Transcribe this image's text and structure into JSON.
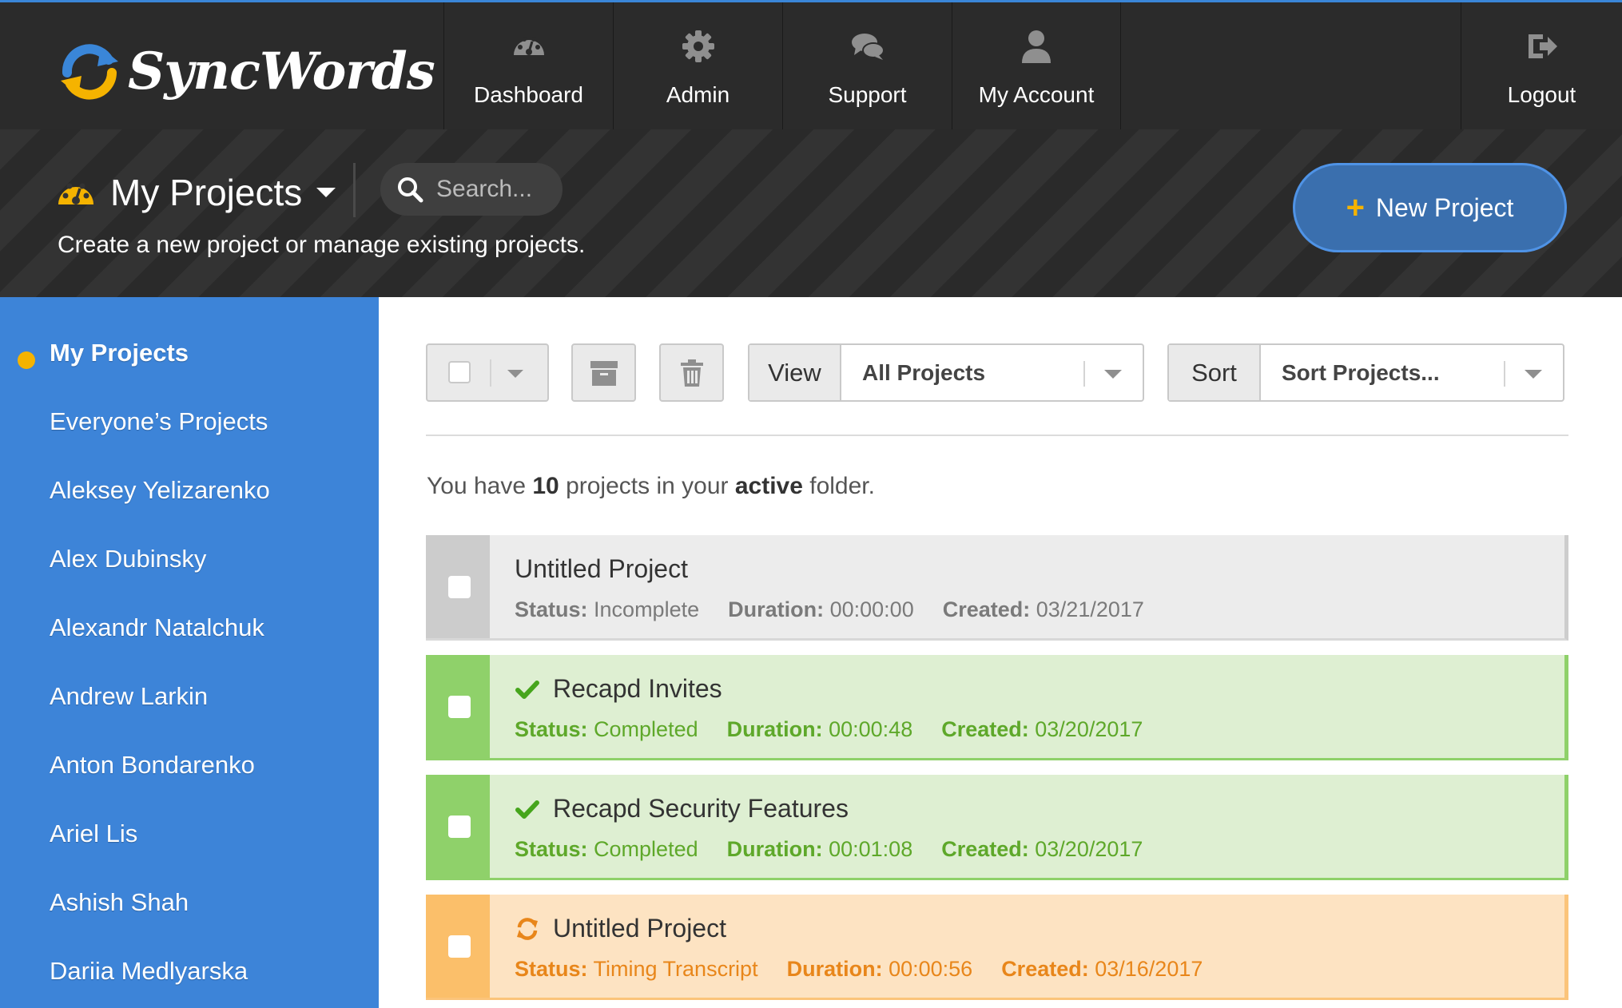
{
  "brand": {
    "name": "SyncWords",
    "logo_icon": "syncwords-logo"
  },
  "topnav": {
    "items": [
      {
        "label": "Dashboard",
        "icon": "dashboard-gauge-icon"
      },
      {
        "label": "Admin",
        "icon": "gear-icon"
      },
      {
        "label": "Support",
        "icon": "chat-bubbles-icon"
      },
      {
        "label": "My Account",
        "icon": "user-icon"
      }
    ],
    "logout": {
      "label": "Logout",
      "icon": "logout-icon"
    }
  },
  "header": {
    "title": "My Projects",
    "search_placeholder": "Search...",
    "subtitle": "Create a new project or manage existing projects.",
    "new_project_label": "New Project"
  },
  "sidebar": {
    "items": [
      "My Projects",
      "Everyone’s Projects",
      "Aleksey Yelizarenko",
      "Alex Dubinsky",
      "Alexandr Natalchuk",
      "Andrew Larkin",
      "Anton Bondarenko",
      "Ariel Lis",
      "Ashish Shah",
      "Dariia Medlyarska"
    ]
  },
  "toolbar": {
    "view_label": "View",
    "view_value": "All Projects",
    "sort_label": "Sort",
    "sort_value": "Sort Projects..."
  },
  "summary": {
    "prefix": "You have ",
    "count": "10",
    "middle": " projects in your ",
    "folder": "active",
    "suffix": " folder."
  },
  "projects": [
    {
      "name": "Untitled Project",
      "state": "incomplete",
      "status_key": "Status:",
      "status": "Incomplete",
      "duration_key": "Duration:",
      "duration": "00:00:00",
      "created_key": "Created:",
      "created": "03/21/2017"
    },
    {
      "name": "Recapd Invites",
      "state": "completed",
      "status_icon": "checkmark-icon",
      "status_key": "Status:",
      "status": "Completed",
      "duration_key": "Duration:",
      "duration": "00:00:48",
      "created_key": "Created:",
      "created": "03/20/2017"
    },
    {
      "name": "Recapd Security Features",
      "state": "completed",
      "status_icon": "checkmark-icon",
      "status_key": "Status:",
      "status": "Completed",
      "duration_key": "Duration:",
      "duration": "00:01:08",
      "created_key": "Created:",
      "created": "03/20/2017"
    },
    {
      "name": "Untitled Project",
      "state": "in-progress",
      "status_icon": "refresh-icon",
      "status_key": "Status:",
      "status": "Timing Transcript",
      "duration_key": "Duration:",
      "duration": "00:00:56",
      "created_key": "Created:",
      "created": "03/16/2017"
    }
  ],
  "colors": {
    "nav_bg": "#2b2b2b",
    "sidebar_bg": "#3d84d8",
    "accent_yellow": "#f5b300",
    "completed_green": "#8fd16a",
    "in_progress_orange": "#fbbf6a",
    "incomplete_gray": "#cccccc"
  }
}
